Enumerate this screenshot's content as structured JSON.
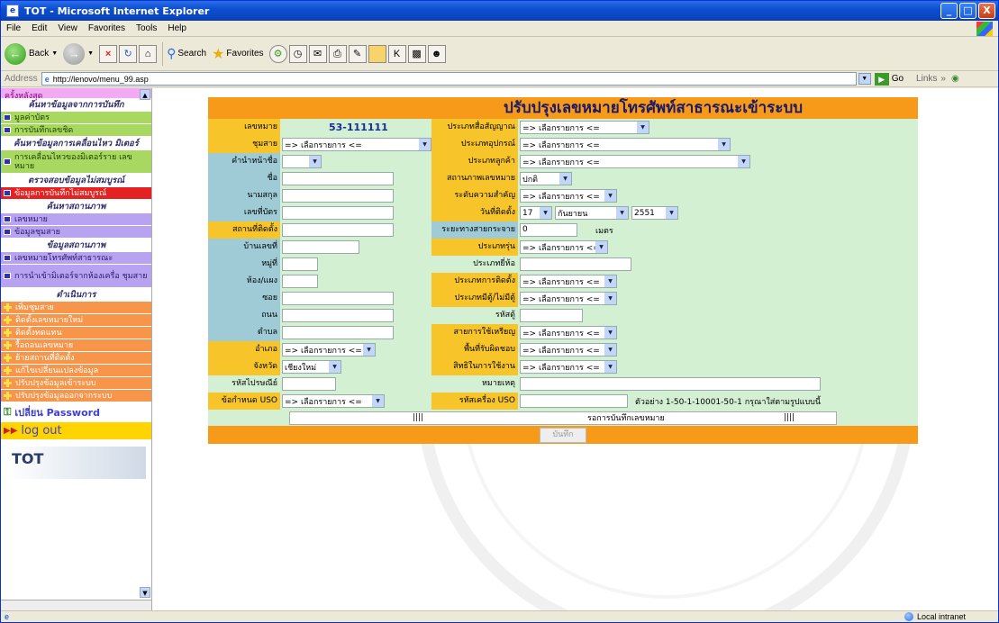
{
  "window": {
    "title": "TOT - Microsoft Internet Explorer",
    "controls": [
      "_",
      "□",
      "X"
    ]
  },
  "menubar": [
    "File",
    "Edit",
    "View",
    "Favorites",
    "Tools",
    "Help"
  ],
  "toolbar": {
    "back_label": "Back",
    "search_label": "Search",
    "favorites_label": "Favorites"
  },
  "addressbar": {
    "label": "Address",
    "url": "http://lenovo/menu_99.asp",
    "go_label": "Go",
    "links_label": "Links"
  },
  "sidebar": {
    "top_item": "ครั้งหลังสุด",
    "sections": [
      {
        "heading": "ค้นหาข้อมูลจากการบันทึก",
        "items": [
          "มูลค่าบัตร",
          "การบันทึกเลขชิด"
        ]
      },
      {
        "heading": "ค้นหาข้อมูลการเคลื่อนไหว มิเตอร์",
        "items": [
          "การเคลื่อนไหวของมิเตอร์ราย เลขหมาย"
        ]
      },
      {
        "heading": "ตรวจสอบข้อมูลไม่สมบูรณ์",
        "items": [
          "ข้อมูลการบันทึกไม่สมบูรณ์"
        ]
      },
      {
        "heading": "ค้นหาสถานภาพ",
        "items": [
          "เลขหมาย",
          "ข้อมูลชุมสาย"
        ]
      },
      {
        "heading": "ข้อมูลสถานภาพ",
        "items": [
          "เลขหมายโทรศัพท์สาธารณะ",
          "การนำเข้ามิเตอร์จากห้องเครื่อ ชุมสาย"
        ]
      },
      {
        "heading": "ดำเนินการ",
        "items": [
          "เพิ่มชุมสาย",
          "ติดตั้งเลขหมายใหม่",
          "ติดตั้งทดแทน",
          "รื้อถอนเลขหมาย",
          "ย้ายสถานที่ติดตั้ง",
          "แก้ไขเปลี่ยนแปลงข้อมูล",
          "ปรับปรุงข้อมูลเข้าระบบ",
          "ปรับปรุงข้อมูลออกจากระบบ"
        ]
      }
    ],
    "change_password": "เปลี่ยน Password",
    "logout": "log out",
    "logo_text": "TOT"
  },
  "form": {
    "title": "ปรับปรุงเลขหมายโทรศัพท์สาธารณะเข้าระบบ",
    "default_option": "=> เลือกรายการ <=",
    "rows": [
      {
        "left_label": "เลขหมาย",
        "left_value": "53-111111",
        "right_label": "ประเภทสื่อสัญญาณ"
      },
      {
        "left_label": "ชุมสาย",
        "right_label": "ประเภทอุปกรณ์"
      },
      {
        "left_label": "คำนำหน้าชื่อ",
        "right_label": "ประเภทลูกค้า"
      },
      {
        "left_label": "ชื่อ",
        "right_label": "สถานภาพเลขหมาย",
        "right_value": "ปกติ"
      },
      {
        "left_label": "นามสกุล",
        "right_label": "ระดับความสำคัญ"
      },
      {
        "left_label": "เลขที่บัตร",
        "right_label": "วันที่ติดตั้ง",
        "day": "17",
        "month": "กันยายน",
        "year": "2551"
      },
      {
        "left_label": "สถานที่ติดตั้ง",
        "right_label": "ระยะทางสายกระจาย",
        "right_value": "0",
        "unit": "เมตร"
      },
      {
        "left_label": "บ้านเลขที่",
        "right_label": "ประเภทรุ่น"
      },
      {
        "left_label": "หมู่ที่",
        "right_label": "ประเภทยี่ห้อ"
      },
      {
        "left_label": "ห้อง/แผง",
        "right_label": "ประเภทการติดตั้ง"
      },
      {
        "left_label": "ซอย",
        "right_label": "ประเภทมีตู้/ไม่มีตู้"
      },
      {
        "left_label": "ถนน",
        "right_label": "รหัสตู้"
      },
      {
        "left_label": "ตำบล",
        "right_label": "สายการใช้เหรียญ"
      },
      {
        "left_label": "อำเภอ",
        "right_label": "พื้นที่รับผิดชอบ"
      },
      {
        "left_label": "จังหวัด",
        "left_value": "เชียงใหม่",
        "right_label": "สิทธิในการใช้งาน"
      },
      {
        "left_label": "รหัสไปรษณีย์",
        "right_label": "หมายเหตุ"
      },
      {
        "left_label": "ข้อกำหนด USO",
        "right_label": "รหัสเครื่อง USO",
        "example": "ตัวอย่าง 1-50-1-10001-50-1 กรุณาใส่ตามรูปแบบนี้"
      }
    ],
    "status": {
      "bars": "||||",
      "message": "รอการบันทึกเลขหมาย"
    },
    "save_label": "บันทึก"
  },
  "statusbar": {
    "zone": "Local intranet"
  }
}
